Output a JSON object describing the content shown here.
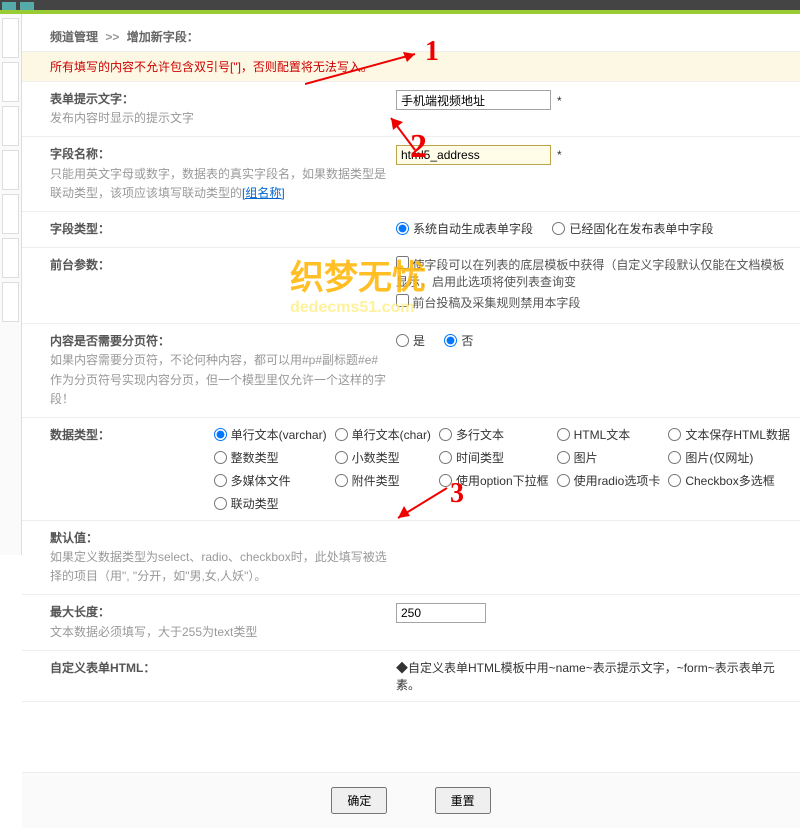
{
  "breadcrumb": {
    "a": "频道管理",
    "sep": ">>",
    "b": "增加新字段："
  },
  "notice": "所有填写的内容不允许包含双引号[\"]，否则配置将无法写入。",
  "rows": {
    "prompt": {
      "title": "表单提示文字：",
      "desc": "发布内容时显示的提示文字",
      "value": "手机端视频地址"
    },
    "fname": {
      "title": "字段名称：",
      "desc": "只能用英文字母或数字，数据表的真实字段名，如果数据类型是联动类型，该项应该填写联动类型的",
      "link": "[组名称]",
      "value": "html5_address"
    },
    "ftype": {
      "title": "字段类型：",
      "opt1": "系统自动生成表单字段",
      "opt2": "已经固化在发布表单中字段"
    },
    "front": {
      "title": "前台参数：",
      "chk1": "使字段可以在列表的底层模板中获得（自定义字段默认仅能在文档模板显示，启用此选项将使列表查询变",
      "chk2": "前台投稿及采集规则禁用本字段"
    },
    "paging": {
      "title": "内容是否需要分页符：",
      "desc": "如果内容需要分页符，不论何种内容，都可以用#p#副标题#e#作为分页符号实现内容分页，但一个模型里仅允许一个这样的字段！",
      "yes": "是",
      "no": "否"
    },
    "dtype": {
      "title": "数据类型：",
      "opts": [
        "单行文本(varchar)",
        "单行文本(char)",
        "多行文本",
        "HTML文本",
        "文本保存HTML数据",
        "整数类型",
        "小数类型",
        "时间类型",
        "图片",
        "图片(仅网址)",
        "多媒体文件",
        "附件类型",
        "使用option下拉框",
        "使用radio选项卡",
        "Checkbox多选框",
        "联动类型"
      ]
    },
    "default": {
      "title": "默认值：",
      "desc": "如果定义数据类型为select、radio、checkbox时，此处填写被选择的项目（用\", \"分开，如\"男,女,人妖\"）。"
    },
    "maxlen": {
      "title": "最大长度：",
      "desc": "文本数据必须填写，大于255为text类型",
      "value": "250"
    },
    "html": {
      "title": "自定义表单HTML：",
      "desc": "◆自定义表单HTML模板中用~name~表示提示文字，~form~表示表单元素。"
    }
  },
  "buttons": {
    "ok": "确定",
    "reset": "重置"
  },
  "watermark": {
    "cn": "织梦无忧",
    "en": "dedecms51.com"
  },
  "annotations": {
    "n1": "1",
    "n2": "2",
    "n3": "3"
  }
}
